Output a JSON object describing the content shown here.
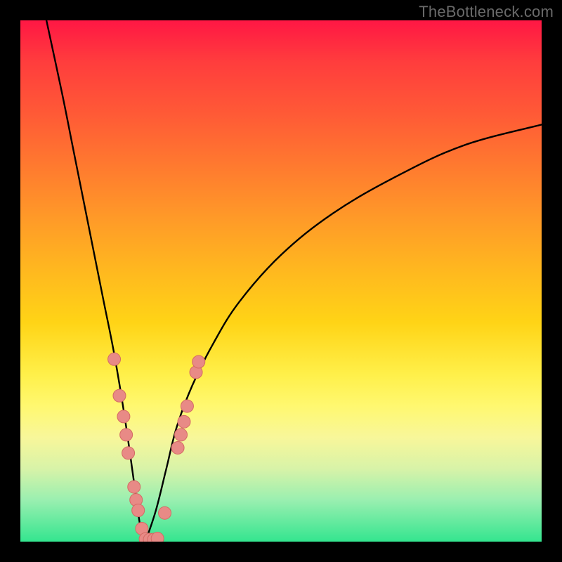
{
  "watermark": "TheBottleneck.com",
  "colors": {
    "curve": "#000000",
    "marker_fill": "#e88a86",
    "marker_stroke": "#d46a64",
    "gradient_top": "#ff1744",
    "gradient_bottom": "#34e58f"
  },
  "chart_data": {
    "type": "line",
    "title": "",
    "xlabel": "",
    "ylabel": "",
    "xlim": [
      0,
      100
    ],
    "ylim": [
      0,
      100
    ],
    "grid": false,
    "legend": false,
    "description": "Bottleneck V-curve; minimum (bottleneck 0%) near x≈24. Left branch rises steeply toward 100%; right branch rises more gently toward ~80% at x=100.",
    "series": [
      {
        "name": "left_branch",
        "x": [
          5,
          8,
          10,
          12,
          14,
          16,
          18,
          20,
          22,
          23,
          24
        ],
        "y": [
          100,
          86,
          76,
          66,
          56,
          46,
          36,
          24,
          10,
          3,
          0
        ]
      },
      {
        "name": "right_branch",
        "x": [
          24,
          26,
          28,
          30,
          33,
          37,
          42,
          50,
          60,
          72,
          85,
          100
        ],
        "y": [
          0,
          6,
          14,
          22,
          30,
          38,
          46,
          55,
          63,
          70,
          76,
          80
        ]
      }
    ],
    "markers": {
      "name": "benchmark-points",
      "note": "Scattered sample points near the valley of the curve",
      "points": [
        {
          "x": 18.0,
          "y": 35.0
        },
        {
          "x": 19.0,
          "y": 28.0
        },
        {
          "x": 19.8,
          "y": 24.0
        },
        {
          "x": 20.3,
          "y": 20.5
        },
        {
          "x": 20.7,
          "y": 17.0
        },
        {
          "x": 21.8,
          "y": 10.5
        },
        {
          "x": 22.2,
          "y": 8.0
        },
        {
          "x": 22.6,
          "y": 6.0
        },
        {
          "x": 23.3,
          "y": 2.5
        },
        {
          "x": 24.0,
          "y": 0.5
        },
        {
          "x": 24.8,
          "y": 0.4
        },
        {
          "x": 25.6,
          "y": 0.4
        },
        {
          "x": 26.3,
          "y": 0.6
        },
        {
          "x": 27.7,
          "y": 5.5
        },
        {
          "x": 30.2,
          "y": 18.0
        },
        {
          "x": 30.8,
          "y": 20.5
        },
        {
          "x": 31.4,
          "y": 23.0
        },
        {
          "x": 32.0,
          "y": 26.0
        },
        {
          "x": 33.7,
          "y": 32.5
        },
        {
          "x": 34.2,
          "y": 34.5
        }
      ]
    }
  }
}
